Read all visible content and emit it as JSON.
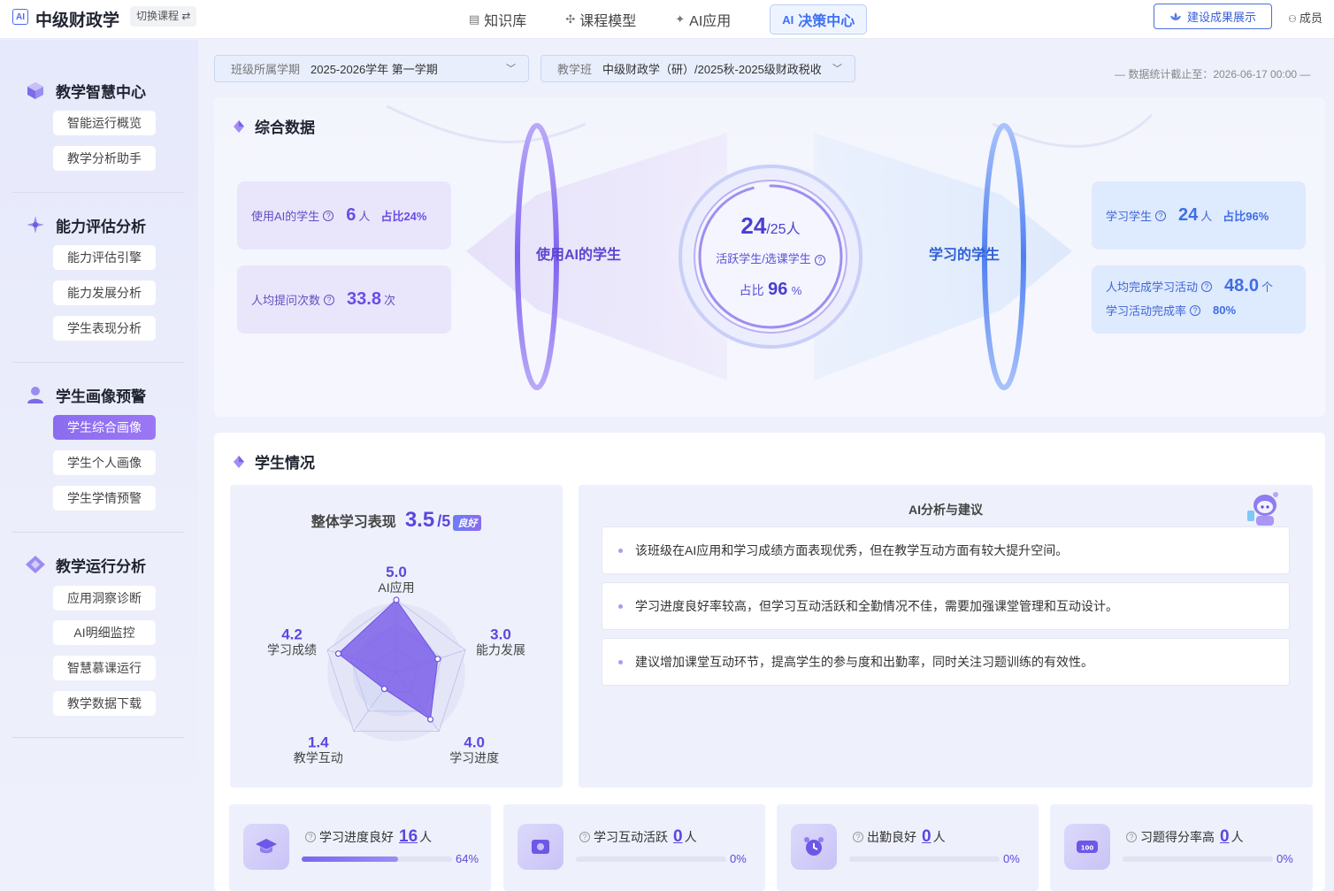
{
  "header": {
    "logo_text": "AI",
    "app_title": "中级财政学",
    "switch_label": "切换课程 ⇄",
    "nav": [
      {
        "icon": "book-icon",
        "glyph": "▤",
        "label": "知识库"
      },
      {
        "icon": "flower-icon",
        "glyph": "✣",
        "label": "课程模型"
      },
      {
        "icon": "sparkle-icon",
        "glyph": "✦",
        "label": "AI应用"
      },
      {
        "icon": "ai-icon",
        "glyph": "AI",
        "label": "决策中心"
      }
    ],
    "build_button": "建设成果展示",
    "member_label": "成员"
  },
  "sidebar": {
    "sections": [
      {
        "title": "教学智慧中心",
        "items": [
          "智能运行概览",
          "教学分析助手"
        ]
      },
      {
        "title": "能力评估分析",
        "items": [
          "能力评估引擎",
          "能力发展分析",
          "学生表现分析"
        ]
      },
      {
        "title": "学生画像预警",
        "items": [
          "学生综合画像",
          "学生个人画像",
          "学生学情预警"
        ],
        "active_index": 0
      },
      {
        "title": "教学运行分析",
        "items": [
          "应用洞察诊断",
          "AI明细监控",
          "智慧慕课运行",
          "教学数据下载"
        ]
      }
    ]
  },
  "filters": {
    "term_label": "班级所属学期",
    "term_value": "2025-2026学年 第一学期",
    "class_label": "教学班",
    "class_value": "中级财政学（研）/2025秋-2025级财政税收"
  },
  "stat_date": "— 数据统计截止至：2026-06-17 00:00 —",
  "overview": {
    "title": "综合数据",
    "left_caption": "使用AI的学生",
    "right_caption": "学习的学生",
    "ai_students_label": "使用AI的学生",
    "ai_students_value": "6",
    "ai_students_unit": "人",
    "ai_students_pct": "占比24%",
    "questions_label": "人均提问次数",
    "questions_value": "33.8",
    "questions_unit": "次",
    "center_active": "24",
    "center_total": "/25人",
    "center_label": "活跃学生/选课学生",
    "center_pct_label": "占比",
    "center_pct_value": "96",
    "center_pct_unit": "%",
    "center_ring_fraction": 0.96,
    "learn_students_label": "学习学生",
    "learn_students_value": "24",
    "learn_students_unit": "人",
    "learn_students_pct": "占比96%",
    "activity_label": "人均完成学习活动",
    "activity_value": "48.0",
    "activity_unit": "个",
    "rate_label": "学习活动完成率",
    "rate_value": "80%"
  },
  "students": {
    "title": "学生情况",
    "overall_label": "整体学习表现",
    "overall_score": "3.5",
    "overall_max": "/5",
    "overall_badge": "良好",
    "radar": [
      {
        "name": "AI应用",
        "value": 5.0,
        "display": "5.0"
      },
      {
        "name": "能力发展",
        "value": 3.0,
        "display": "3.0"
      },
      {
        "name": "学习进度",
        "value": 4.0,
        "display": "4.0"
      },
      {
        "name": "教学互动",
        "value": 1.4,
        "display": "1.4"
      },
      {
        "name": "学习成绩",
        "value": 4.2,
        "display": "4.2"
      }
    ],
    "radar_max": 5,
    "ai_title": "AI分析与建议",
    "suggestions": [
      "该班级在AI应用和学习成绩方面表现优秀，但在教学互动方面有较大提升空间。",
      "学习进度良好率较高，但学习互动活跃和全勤情况不佳，需要加强课堂管理和互动设计。",
      "建议增加课堂互动环节，提高学生的参与度和出勤率，同时关注习题训练的有效性。"
    ],
    "stats": [
      {
        "icon": "graduation-cap-icon",
        "label": "学习进度良好",
        "value": "16",
        "unit": "人",
        "pct": "64%",
        "fraction": 0.64
      },
      {
        "icon": "interaction-icon",
        "label": "学习互动活跃",
        "value": "0",
        "unit": "人",
        "pct": "0%",
        "fraction": 0
      },
      {
        "icon": "clock-icon",
        "label": "出勤良好",
        "value": "0",
        "unit": "人",
        "pct": "0%",
        "fraction": 0
      },
      {
        "icon": "score-100-icon",
        "label": "习题得分率高",
        "value": "0",
        "unit": "人",
        "pct": "0%",
        "fraction": 0
      }
    ]
  },
  "colors": {
    "primary_blue": "#3f71f5",
    "primary_purple": "#6b4ce6",
    "accent_violet": "#8b6cf0"
  }
}
